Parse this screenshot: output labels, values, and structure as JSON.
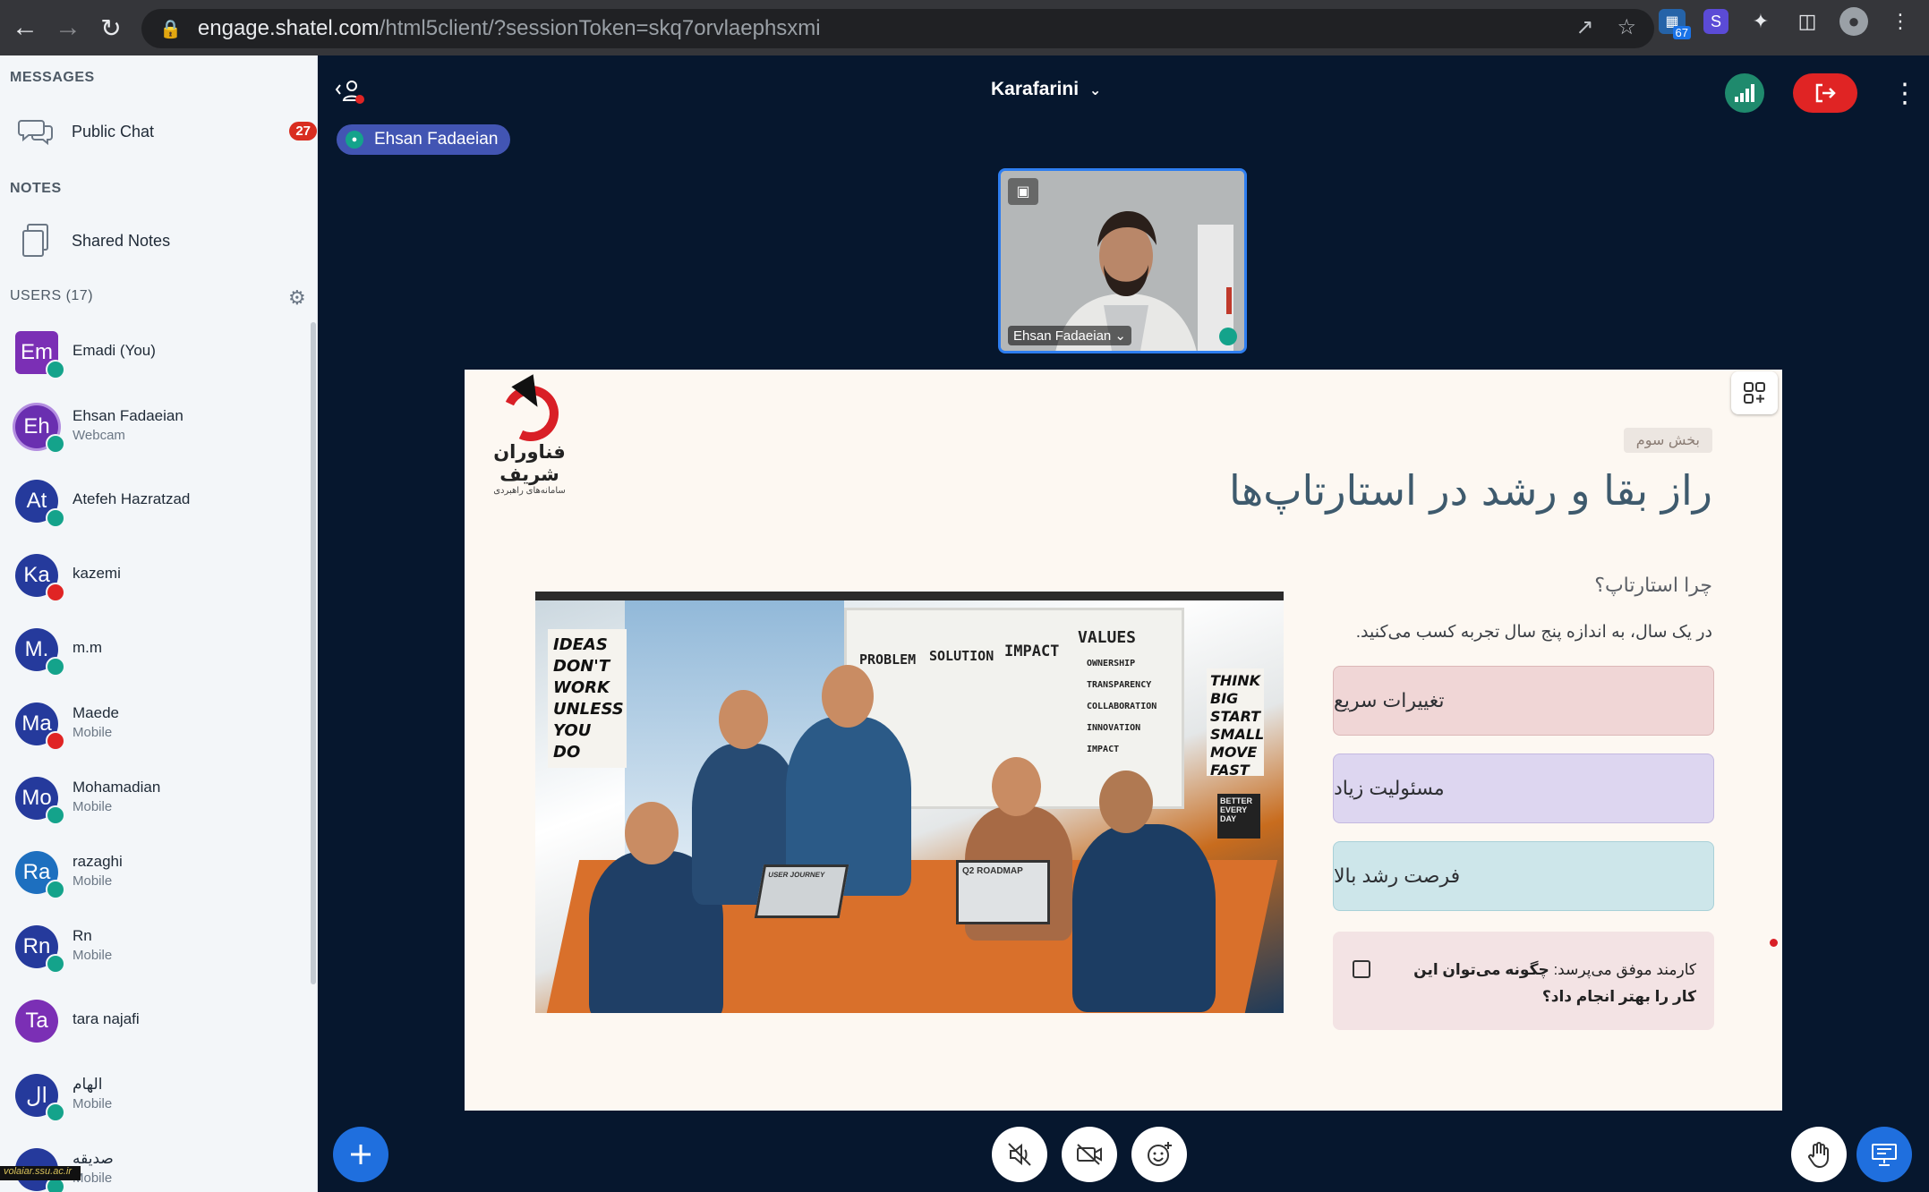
{
  "browser": {
    "url_host": "engage.shatel.com",
    "url_path": "/html5client/?sessionToken=skq7orvlaephsxmi",
    "extension_badge": "67"
  },
  "sidebar": {
    "messages_label": "MESSAGES",
    "public_chat": "Public Chat",
    "public_chat_count": "27",
    "notes_label": "NOTES",
    "shared_notes": "Shared Notes",
    "users_label": "USERS (17)",
    "users": [
      {
        "initials": "Em",
        "name": "Emadi (You)",
        "sub": "",
        "color": "#7b2fb5"
      },
      {
        "initials": "Eh",
        "name": "Ehsan Fadaeian",
        "sub": "Webcam",
        "color": "#6a2fb0"
      },
      {
        "initials": "At",
        "name": "Atefeh Hazratzad",
        "sub": "",
        "color": "#253a9c"
      },
      {
        "initials": "Ka",
        "name": "kazemi",
        "sub": "",
        "color": "#253a9c"
      },
      {
        "initials": "M.",
        "name": "m.m",
        "sub": "",
        "color": "#253a9c"
      },
      {
        "initials": "Ma",
        "name": "Maede",
        "sub": "Mobile",
        "color": "#253a9c"
      },
      {
        "initials": "Mo",
        "name": "Mohamadian",
        "sub": "Mobile",
        "color": "#253a9c"
      },
      {
        "initials": "Ra",
        "name": "razaghi",
        "sub": "Mobile",
        "color": "#1d6fbf"
      },
      {
        "initials": "Rn",
        "name": "Rn",
        "sub": "Mobile",
        "color": "#253a9c"
      },
      {
        "initials": "Ta",
        "name": "tara najafi",
        "sub": "",
        "color": "#7b2fb5"
      },
      {
        "initials": "ال",
        "name": "الهام",
        "sub": "Mobile",
        "color": "#253a9c"
      },
      {
        "initials": "",
        "name": "صدیقه",
        "sub": "Mobile",
        "color": "#253a9c"
      }
    ]
  },
  "main": {
    "meeting_title": "Karafarini",
    "speaker_name": "Ehsan Fadaeian",
    "webcam_name": "Ehsan Fadaeian"
  },
  "slide": {
    "logo_name": "فناوران شریف",
    "logo_sub": "سامانه‌های راهبردی",
    "tag": "بخش سوم",
    "title": "راز بقا و رشد در استارتاپ‌ها",
    "question": "چرا استارتاپ؟",
    "line": "در یک سال، به اندازه پنج سال تجربه کسب می‌کنید.",
    "boxes": [
      "تغییرات سریع",
      "مسئولیت زیاد",
      "فرصت رشد بالا"
    ],
    "note_prefix": "کارمند موفق می‌پرسد: ",
    "note_bold": "چگونه می‌توان این کار را بهتر انجام داد؟",
    "image_texts": {
      "poster_left": "IDEAS DON'T WORK UNLESS YOU DO",
      "poster_right": "THINK BIG START SMALL MOVE FAST",
      "wb_problem": "PROBLEM",
      "wb_solution": "SOLUTION",
      "wb_impact": "IMPACT",
      "wb_values": "VALUES",
      "wb_v1": "OWNERSHIP",
      "wb_v2": "TRANSPARENCY",
      "wb_v3": "COLLABORATION",
      "wb_v4": "INNOVATION",
      "wb_v5": "IMPACT",
      "laptop": "Q2 ROADMAP",
      "laptop2": "USER JOURNEY",
      "better": "BETTER EVERY DAY"
    }
  },
  "watermark": "volaiar.ssu.ac.ir"
}
